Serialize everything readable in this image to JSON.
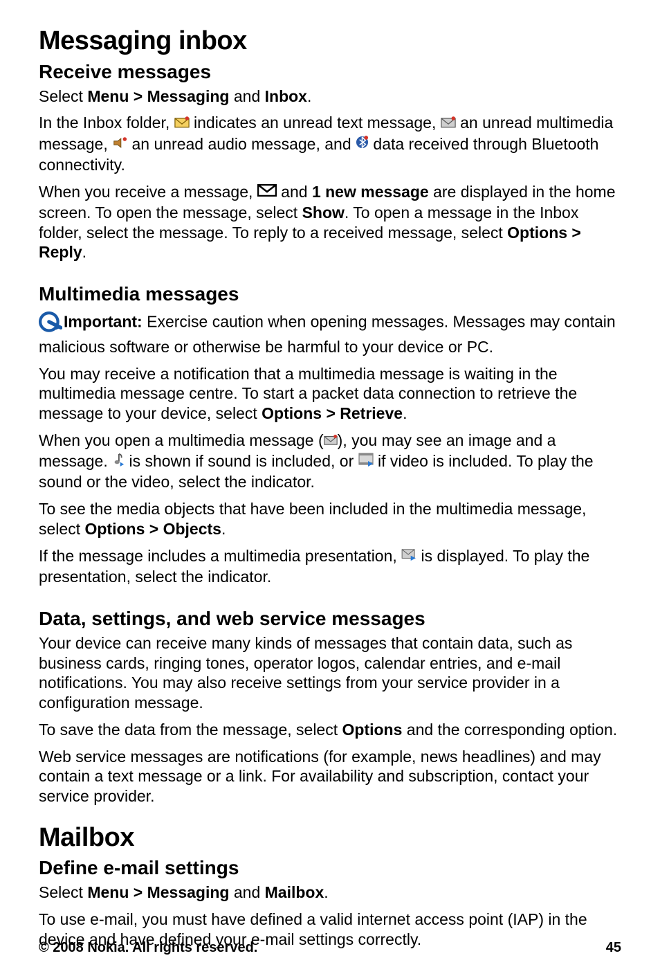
{
  "h1_inbox": "Messaging inbox",
  "h2_receive": "Receive messages",
  "p_select1_a": "Select ",
  "p_select1_menu": "Menu",
  "p_select1_gt": " > ",
  "p_select1_msg": "Messaging",
  "p_select1_and": " and ",
  "p_select1_inbox": "Inbox",
  "p_select1_end": ".",
  "p_inbox_a": "In the Inbox folder, ",
  "p_inbox_b": " indicates an unread text message, ",
  "p_inbox_c": " an unread multimedia message, ",
  "p_inbox_d": " an unread audio message, and ",
  "p_inbox_e": " data received through Bluetooth connectivity.",
  "p_recv_a": "When you receive a message, ",
  "p_recv_b": " and ",
  "p_recv_bold1": "1 new message",
  "p_recv_c": " are displayed in the home screen. To open the message, select ",
  "p_recv_show": "Show",
  "p_recv_d": ". To open a message in the Inbox folder, select the message. To reply to a received message, select ",
  "p_recv_opt": "Options",
  "p_recv_gt": " > ",
  "p_recv_reply": "Reply",
  "p_recv_end": ".",
  "h2_mm": "Multimedia messages",
  "p_imp_label": "Important:",
  "p_imp_text": " Exercise caution when opening messages. Messages may contain malicious software or otherwise be harmful to your device or PC.",
  "p_mm_notify_a": "You may receive a notification that a multimedia message is waiting in the multimedia message centre. To start a packet data connection to retrieve the message to your device, select ",
  "p_mm_notify_opt": "Options",
  "p_mm_notify_gt": " > ",
  "p_mm_notify_ret": "Retrieve",
  "p_mm_notify_end": ".",
  "p_mm_open_a": "When you open a multimedia message (",
  "p_mm_open_b": "), you may see an image and a message. ",
  "p_mm_open_c": " is shown if sound is included, or ",
  "p_mm_open_d": " if video is included. To play the sound or the video, select the indicator.",
  "p_obj_a": "To see the media objects that have been included in the multimedia message, select ",
  "p_obj_opt": "Options",
  "p_obj_gt": " > ",
  "p_obj_objs": "Objects",
  "p_obj_end": ".",
  "p_pres_a": "If the message includes a multimedia presentation, ",
  "p_pres_b": " is displayed. To play the presentation, select the indicator.",
  "h2_data": "Data, settings, and web service messages",
  "p_data1": "Your device can receive many kinds of messages that contain data, such as business cards, ringing tones, operator logos, calendar entries, and e-mail notifications. You may also receive settings from your service provider in a configuration message.",
  "p_data2_a": "To save the data from the message, select ",
  "p_data2_opt": "Options",
  "p_data2_b": " and the corresponding option.",
  "p_data3": "Web service messages are notifications (for example, news headlines) and may contain a text message or a link. For availability and subscription, contact your service provider.",
  "h1_mailbox": "Mailbox",
  "h2_email": "Define e-mail settings",
  "p_email_sel_a": "Select ",
  "p_email_sel_menu": "Menu",
  "p_email_sel_gt": " > ",
  "p_email_sel_msg": "Messaging",
  "p_email_sel_and": " and ",
  "p_email_sel_mb": "Mailbox",
  "p_email_sel_end": ".",
  "p_email_iap": "To use e-mail, you must have defined a valid internet access point (IAP) in the device and have defined your e-mail settings correctly.",
  "footer_copy": "© 2008 Nokia. All rights reserved.",
  "footer_page": "45"
}
